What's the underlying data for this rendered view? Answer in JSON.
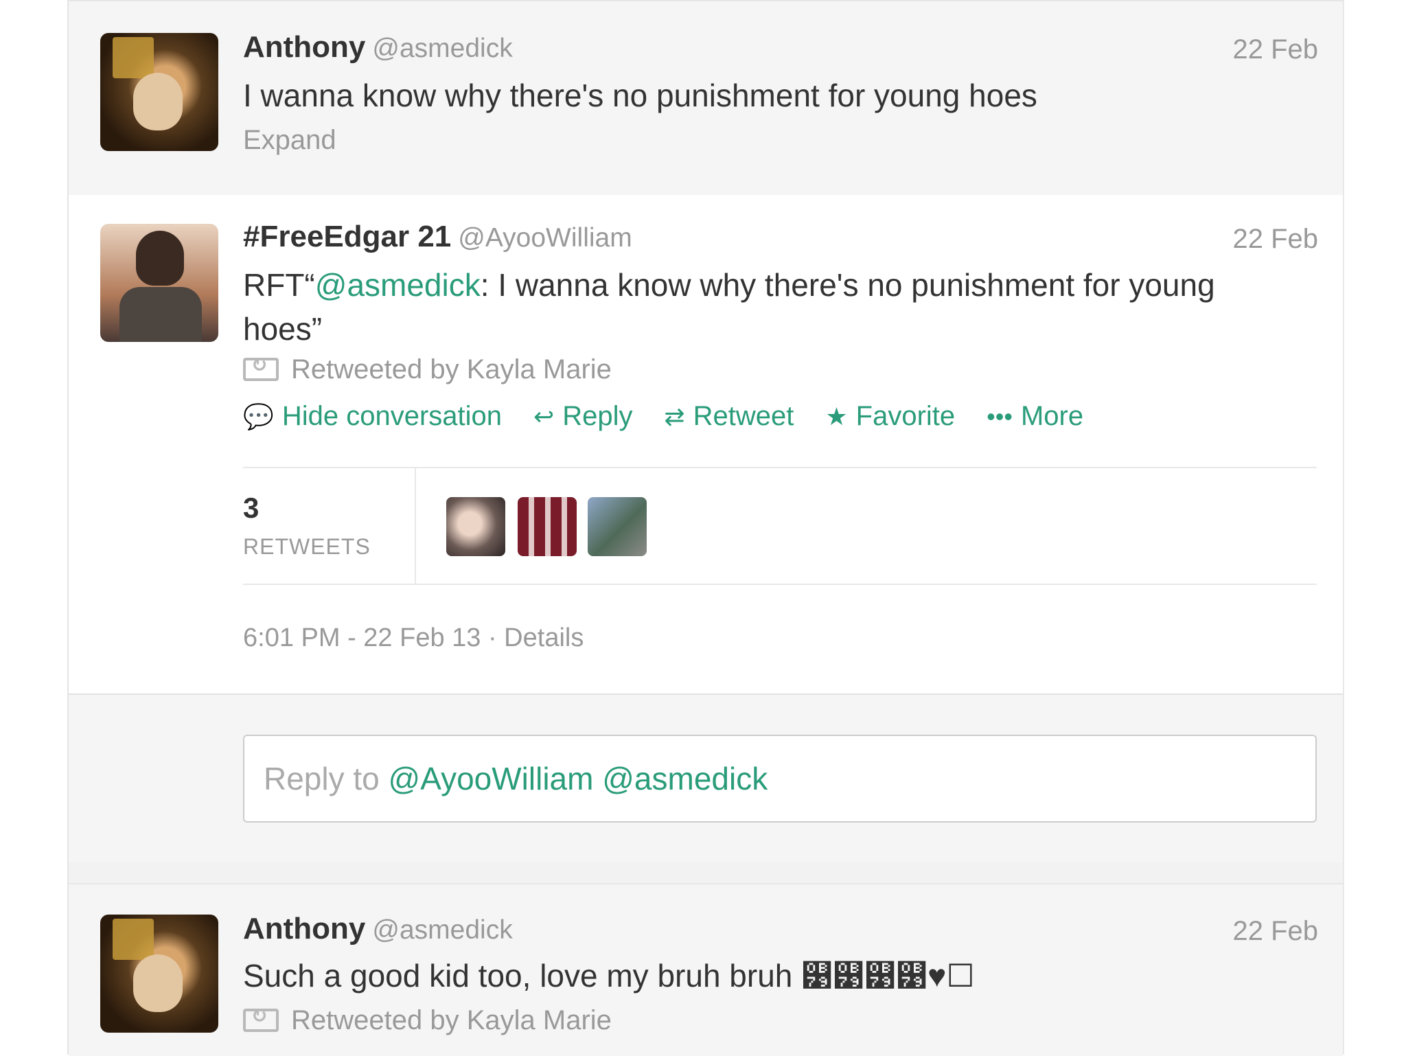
{
  "tweets": {
    "first": {
      "name": "Anthony",
      "handle": "@asmedick",
      "date": "22 Feb",
      "text": "I wanna know why there's no punishment for young hoes",
      "expand": "Expand"
    },
    "main": {
      "name": "#FreeEdgar 21",
      "handle": "@AyooWilliam",
      "date": "22 Feb",
      "text_prefix": "RFT“",
      "text_mention": "@asmedick",
      "text_line1_rest": ": I wanna know why there's no punishment for young",
      "text_line2": "hoes”",
      "retweeted_by": "Retweeted by Kayla Marie",
      "actions": {
        "hide": "Hide conversation",
        "reply": "Reply",
        "retweet": "Retweet",
        "favorite": "Favorite",
        "more": "More"
      },
      "retweet_count": "3",
      "retweet_label": "RETWEETS",
      "timestamp": "6:01 PM - 22 Feb 13 · Details"
    },
    "last": {
      "name": "Anthony",
      "handle": "@asmedick",
      "date": "22 Feb",
      "text": "Such a good kid too, love my bruh bruh ୹୹୹୹♥☐",
      "retweeted_by": "Retweeted by Kayla Marie"
    }
  },
  "reply_box": {
    "prefix": "Reply to ",
    "mentions": "@AyooWilliam @asmedick"
  },
  "colors": {
    "accent": "#2a9c7a",
    "muted": "#999999",
    "text": "#333333"
  }
}
